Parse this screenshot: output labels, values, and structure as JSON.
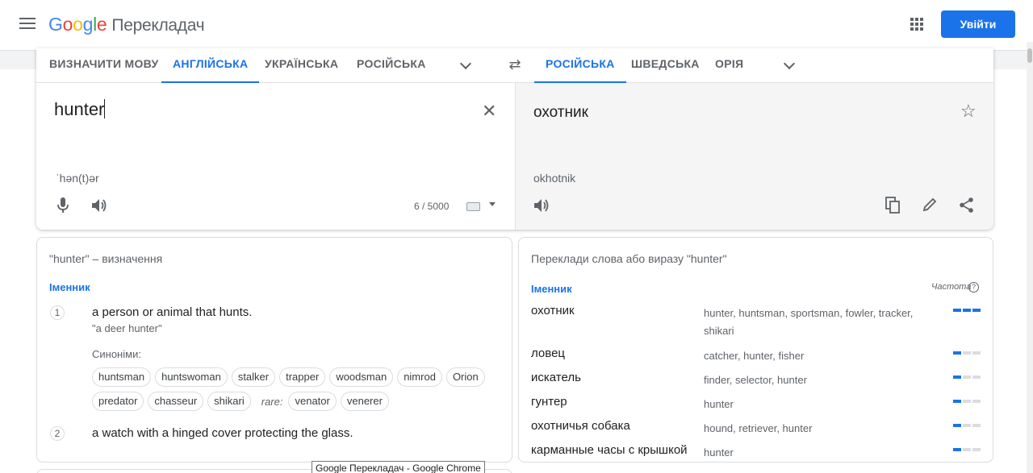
{
  "header": {
    "logo": {
      "g1": "G",
      "g2": "o",
      "g3": "o",
      "g4": "g",
      "g5": "l",
      "g6": "e"
    },
    "product": "Перекладач",
    "signin_label": "Увійти"
  },
  "source_langs": [
    "ВИЗНАЧИТИ МОВУ",
    "АНГЛІЙСЬКА",
    "УКРАЇНСЬКА",
    "РОСІЙСЬКА"
  ],
  "target_langs": [
    "РОСІЙСЬКА",
    "ШВЕДСЬКА",
    "ОРІЯ"
  ],
  "source": {
    "text": "hunter",
    "transliteration": "ˈhən(t)ər",
    "char_count": "6 / 5000"
  },
  "target": {
    "text": "охотник",
    "transliteration": "okhotnik"
  },
  "definitions": {
    "title": "\"hunter\" – визначення",
    "pos": "Іменник",
    "items": [
      {
        "num": "1",
        "text": "a person or animal that hunts.",
        "example": "\"a deer hunter\""
      },
      {
        "num": "2",
        "text": "a watch with a hinged cover protecting the glass."
      }
    ],
    "synonyms_label": "Синоніми:",
    "synonyms_row1": [
      "huntsman",
      "huntswoman",
      "stalker",
      "trapper",
      "woodsman",
      "nimrod",
      "Orion"
    ],
    "synonyms_row2": [
      "predator",
      "chasseur",
      "shikari"
    ],
    "rare_label": "rare:",
    "rare_synonyms": [
      "venator",
      "venerer"
    ]
  },
  "translations": {
    "title": "Переклади слова або виразу \"hunter\"",
    "pos": "Іменник",
    "freq_label": "Частота",
    "rows": [
      {
        "word": "охотник",
        "back": "hunter, huntsman, sportsman, fowler, tracker, shikari",
        "freq": 3
      },
      {
        "word": "ловец",
        "back": "catcher, hunter, fisher",
        "freq": 1
      },
      {
        "word": "искатель",
        "back": "finder, selector, hunter",
        "freq": 1
      },
      {
        "word": "гунтер",
        "back": "hunter",
        "freq": 1
      },
      {
        "word": "охотничья собака",
        "back": "hound, retriever, hunter",
        "freq": 1
      },
      {
        "word": "карманные часы с крышкой",
        "back": "hunter",
        "freq": 1
      }
    ]
  },
  "tooltip": "Google Перекладач - Google Chrome",
  "colors": {
    "accent": "#1a73e8",
    "bar_off": "#dadce0"
  },
  "icons": [
    "menu-icon",
    "apps-icon",
    "swap-icon",
    "close-icon",
    "star-icon",
    "mic-icon",
    "speaker-icon",
    "keyboard-icon",
    "copy-icon",
    "edit-icon",
    "share-icon",
    "help-icon"
  ]
}
